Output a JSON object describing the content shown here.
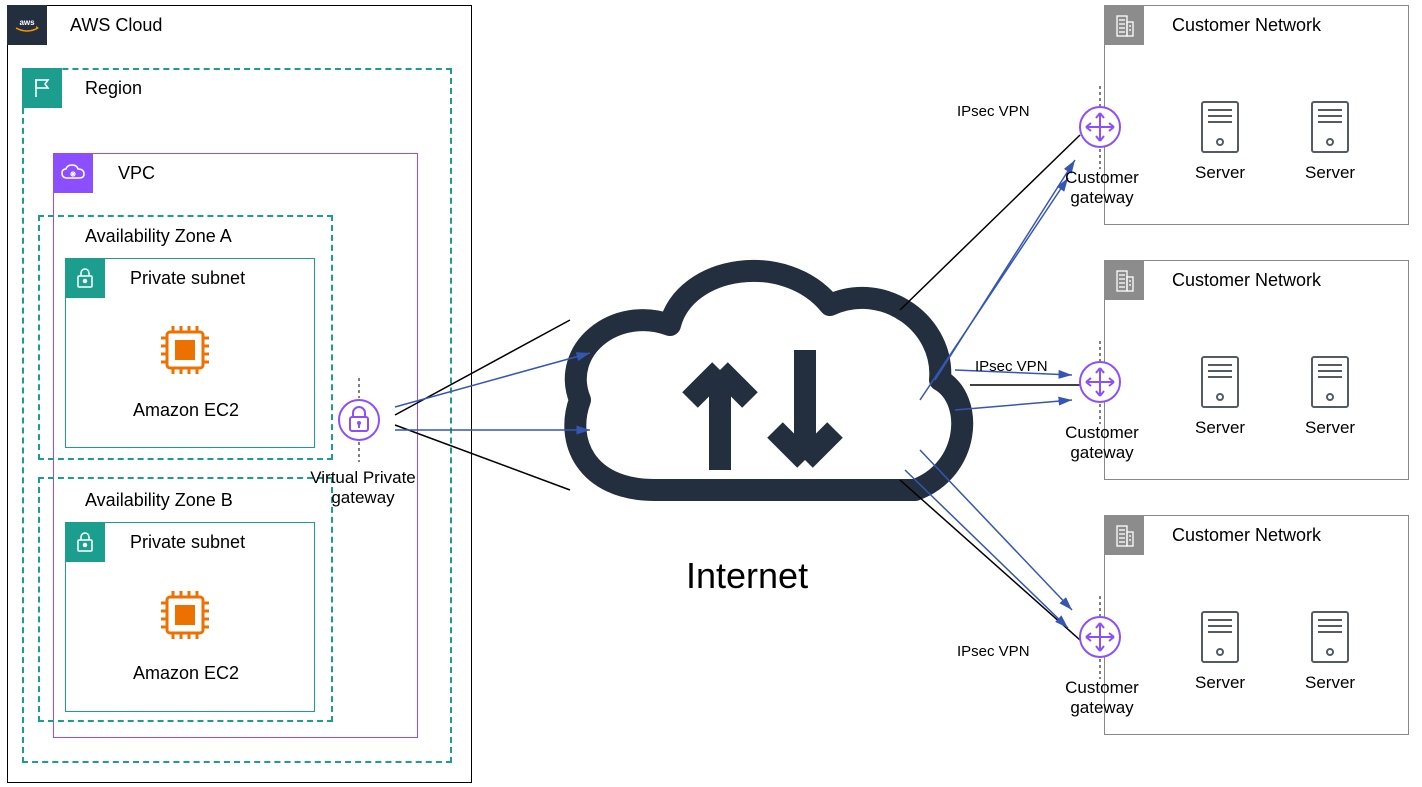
{
  "aws_cloud_label": "AWS Cloud",
  "region_label": "Region",
  "vpc_label": "VPC",
  "az_a_label": "Availability Zone A",
  "az_b_label": "Availability Zone B",
  "private_subnet_label": "Private subnet",
  "ec2_label": "Amazon EC2",
  "vpg_label_line1": "Virtual Private",
  "vpg_label_line2": "gateway",
  "internet_label": "Internet",
  "ipsec_label": "IPsec VPN",
  "customer_network_label": "Customer Network",
  "customer_gateway_label_line1": "Customer",
  "customer_gateway_label_line2": "gateway",
  "server_label": "Server",
  "colors": {
    "teal": "#1B9E8E",
    "purple": "#8C4FFF",
    "orange": "#ED7100",
    "darkslate": "#232F3E",
    "gray": "#8C8C8C",
    "blue_arrow": "#3656B3"
  }
}
